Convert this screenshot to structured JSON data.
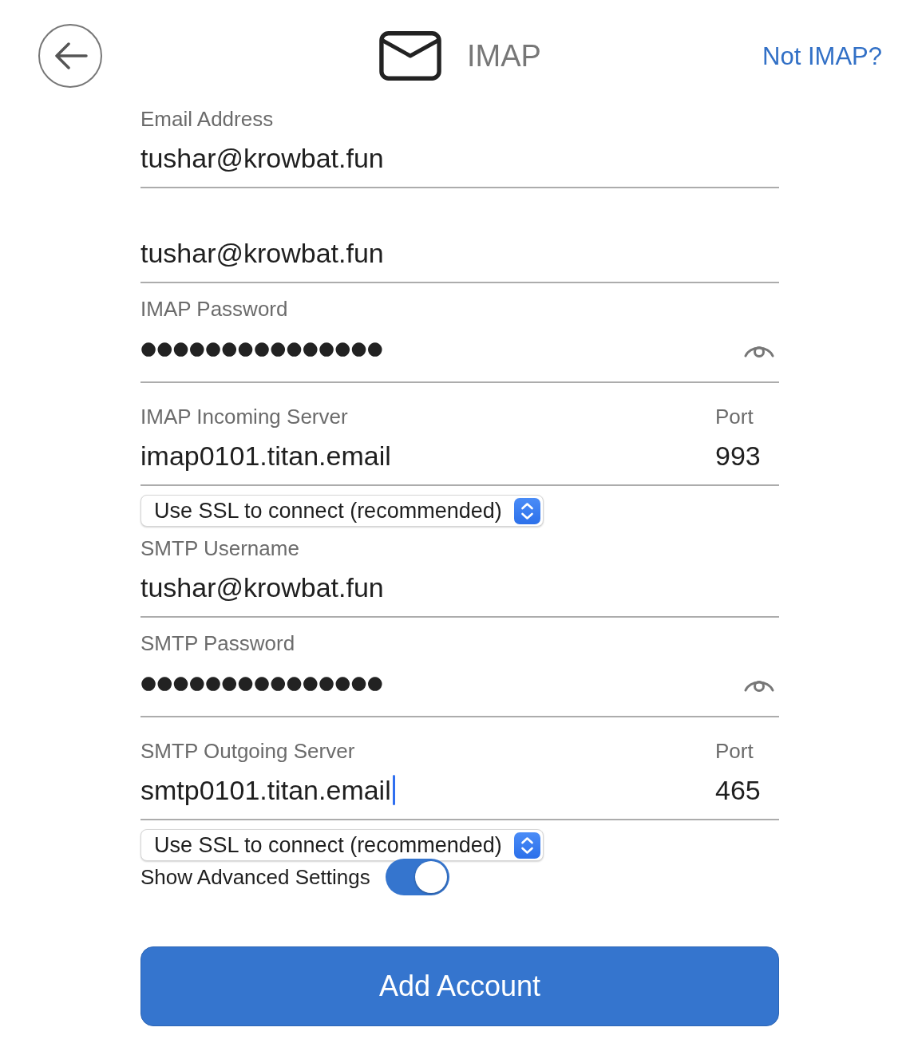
{
  "header": {
    "title": "IMAP",
    "link": "Not IMAP?"
  },
  "fields": [
    {
      "kind": "text",
      "label": "Email Address",
      "value": "tushar@krowbat.fun",
      "focused": false
    },
    {
      "kind": "text",
      "value": "tushar@krowbat.fun",
      "focused": false
    },
    {
      "kind": "password",
      "label": "IMAP Password",
      "value": "●●●●●●●●●●●●●●●",
      "focused": false
    },
    {
      "kind": "server",
      "label": "IMAP Incoming Server",
      "value": "imap0101.titan.email",
      "focused": false,
      "port_label": "Port",
      "port": "993"
    },
    {
      "kind": "select",
      "value": "Use SSL to connect (recommended)"
    },
    {
      "kind": "text",
      "label": "SMTP Username",
      "value": "tushar@krowbat.fun",
      "focused": false
    },
    {
      "kind": "password",
      "label": "SMTP Password",
      "value": "●●●●●●●●●●●●●●●",
      "focused": false
    },
    {
      "kind": "server",
      "label": "SMTP Outgoing Server",
      "value": "smtp0101.titan.email",
      "focused": true,
      "port_label": "Port",
      "port": "465"
    },
    {
      "kind": "select",
      "value": "Use SSL to connect (recommended)"
    },
    {
      "kind": "toggle",
      "label": "Show Advanced Settings",
      "on": true
    }
  ],
  "submit": {
    "label": "Add Account"
  }
}
